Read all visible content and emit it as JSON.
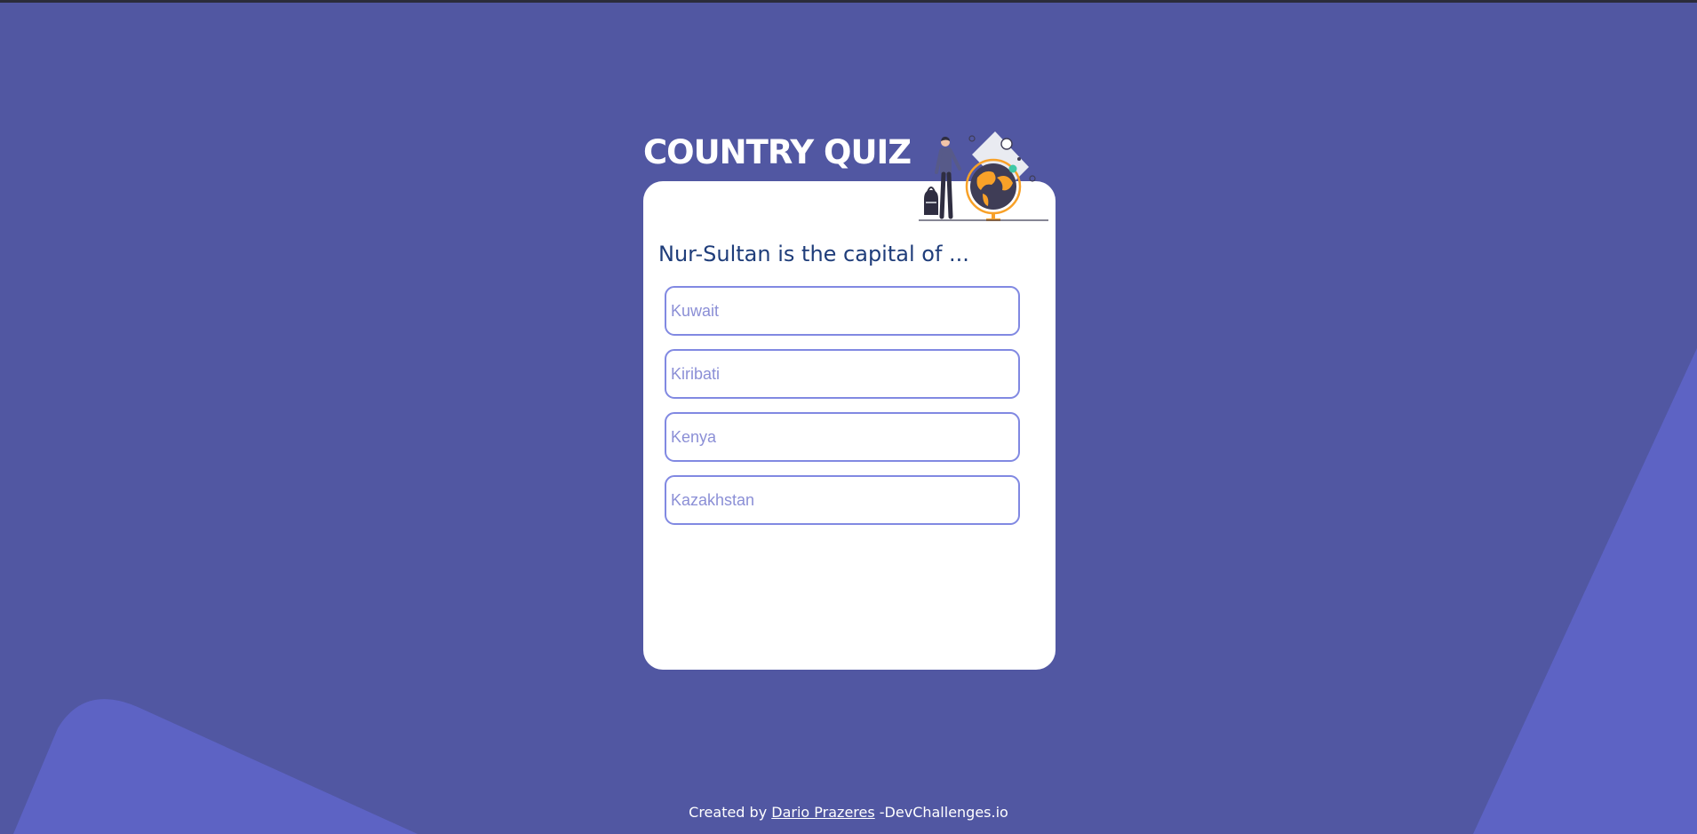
{
  "quiz": {
    "title": "COUNTRY QUIZ",
    "question": "Nur-Sultan is the capital of ...",
    "options": [
      {
        "label": "Kuwait"
      },
      {
        "label": "Kiribati"
      },
      {
        "label": "Kenya"
      },
      {
        "label": "Kazakhstan"
      }
    ]
  },
  "illustration": {
    "icon": "traveler-globe-illustration"
  },
  "footer": {
    "prefix": "Created by",
    "author": "Dario Prazeres",
    "suffix": "-DevChallenges.io"
  },
  "colors": {
    "background": "#5157a2",
    "background_shape": "#5d63c4",
    "card": "#ffffff",
    "question_text": "#1f3d7a",
    "option_border": "#8189e2",
    "option_text": "#8b8fd6",
    "globe": "#f8a128"
  }
}
